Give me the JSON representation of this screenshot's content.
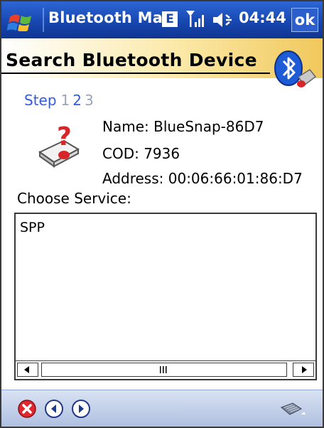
{
  "titlebar": {
    "app_title": "Bluetooth Mar",
    "e_badge": "E",
    "clock": "04:44",
    "ok_label": "ok"
  },
  "header": {
    "title": "Search Bluetooth Device"
  },
  "steps": {
    "word": "Step",
    "step1": "1",
    "step2": "2",
    "step3": "3",
    "current": 2
  },
  "device": {
    "name": "Name: BlueSnap-86D7",
    "cod": "COD: 7936",
    "address": "Address: 00:06:66:01:86:D7"
  },
  "service": {
    "label": "Choose Service:",
    "items": [
      "SPP"
    ]
  },
  "colors": {
    "titlebar": "#1747b0",
    "step_active": "#2f5be7",
    "step_inactive": "#9aa4b8",
    "close_red": "#e0272f"
  },
  "icons": {
    "start": "windows-flag-icon",
    "signal": "signal-icon",
    "volume": "volume-icon",
    "bluetooth": "bluetooth-icon",
    "device_unknown": "device-unknown-icon",
    "close": "close-icon",
    "back": "back-icon",
    "forward": "forward-icon",
    "keyboard": "keyboard-icon"
  }
}
